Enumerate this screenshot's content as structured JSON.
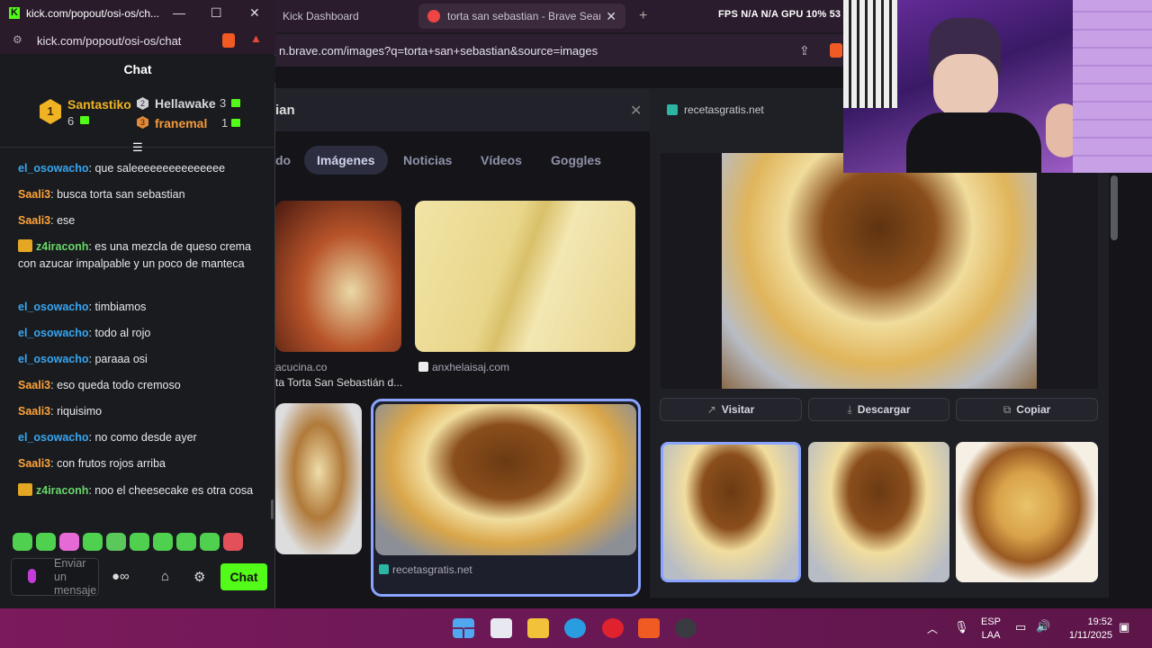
{
  "chat_window": {
    "title": "kick.com/popout/osi-os/ch...",
    "url": "kick.com/popout/osi-os/chat",
    "header": "Chat",
    "leaderboard": {
      "first": {
        "rank": "1",
        "name": "Santastiko",
        "count": "6"
      },
      "second": {
        "rank": "2",
        "name": "Hellawake",
        "count": "3"
      },
      "third": {
        "rank": "3",
        "name": "franemal",
        "count": "1"
      }
    },
    "messages": [
      {
        "user": "el_osowacho",
        "text": ": que saleeeeeeeeeeeeeee",
        "color": "#37a6f0",
        "badge": false
      },
      {
        "user": "Saali3",
        "text": ": busca torta san sebastian",
        "color": "#ffa33a",
        "badge": false
      },
      {
        "user": "Saali3",
        "text": ": ese",
        "color": "#ffa33a",
        "badge": false
      },
      {
        "user": "z4iraconh",
        "text": ": es una mezcla de queso crema con azucar impalpable y un poco de manteca",
        "color": "#6ad66a",
        "badge": true
      },
      {
        "user": "el_osowacho",
        "text": ": timbiamos",
        "color": "#37a6f0",
        "badge": false
      },
      {
        "user": "el_osowacho",
        "text": ": todo al rojo",
        "color": "#37a6f0",
        "badge": false
      },
      {
        "user": "el_osowacho",
        "text": ": paraaa osi",
        "color": "#37a6f0",
        "badge": false
      },
      {
        "user": "Saali3",
        "text": ": eso queda todo cremoso",
        "color": "#ffa33a",
        "badge": false
      },
      {
        "user": "Saali3",
        "text": ": riquisimo",
        "color": "#ffa33a",
        "badge": false
      },
      {
        "user": "el_osowacho",
        "text": ": no como desde ayer",
        "color": "#37a6f0",
        "badge": false
      },
      {
        "user": "Saali3",
        "text": ": con frutos rojos arriba",
        "color": "#ffa33a",
        "badge": false
      },
      {
        "user": "z4iraconh",
        "text": ": noo el cheesecake es otra cosa",
        "color": "#6ad66a",
        "badge": true
      }
    ],
    "input_placeholder": "Enviar un mensaje",
    "send_label": "Chat"
  },
  "browser": {
    "tab_kick": "Kick Dashboard",
    "tab_active": "torta san sebastian - Brave Searc",
    "url": "n.brave.com/images?q=torta+san+sebastian&source=images",
    "stats": "FPS  N/A  N/A  GPU 10% 53",
    "search_query": "ian",
    "filter_tabs": [
      "do",
      "Imágenes",
      "Noticias",
      "Vídeos",
      "Goggles"
    ],
    "result_sources": {
      "r1": "acucina.co",
      "r1_title": "ta Torta San Sebastián d...",
      "r2": "anxhelaisaj.com",
      "r3": "recetasgratis.net"
    },
    "panel": {
      "source": "recetasgratis.net",
      "visit": "Visitar",
      "download": "Descargar",
      "copy": "Copiar"
    }
  },
  "taskbar": {
    "lang1": "ESP",
    "lang2": "LAA",
    "time": "19:52",
    "date": "1/11/2025"
  }
}
